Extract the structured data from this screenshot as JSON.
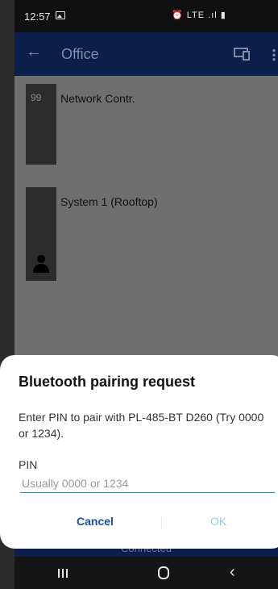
{
  "status_bar": {
    "time": "12:57",
    "icons": "⏰ LTE .ıl ▮"
  },
  "app_bar": {
    "title": "Office",
    "back_icon": "←"
  },
  "devices": [
    {
      "number": "99",
      "name": "Network Contr."
    },
    {
      "name": "System 1 (Rooftop)"
    }
  ],
  "connection_status": "Connected",
  "dialog": {
    "title": "Bluetooth pairing request",
    "message": "Enter PIN to pair with PL-485-BT D260 (Try 0000 or 1234).",
    "pin_label": "PIN",
    "pin_placeholder": "Usually 0000 or 1234",
    "pin_value": "",
    "cancel_label": "Cancel",
    "ok_label": "OK"
  },
  "nav": {
    "back_glyph": "‹"
  },
  "colors": {
    "app_bar": "#0a1f49",
    "accent": "#1a8fd8",
    "cancel": "#1a4fa0",
    "ok_disabled": "#9cc7e6"
  }
}
